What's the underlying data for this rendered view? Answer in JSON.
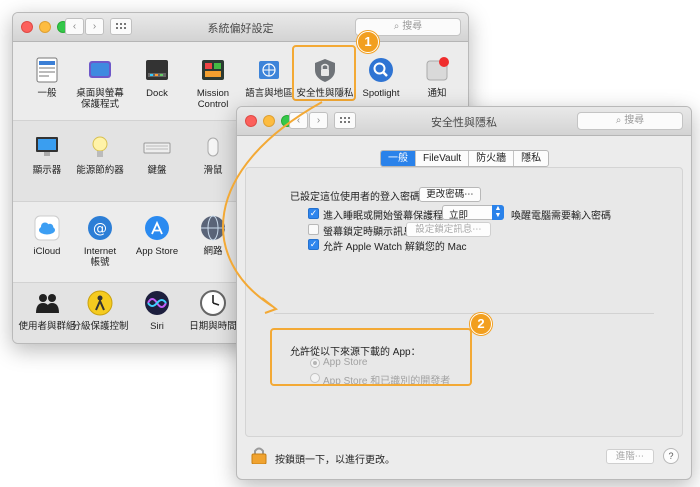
{
  "back_window": {
    "title": "系統偏好設定",
    "search_placeholder": "搜尋",
    "nav_back": "‹",
    "nav_forward": "›",
    "row1": [
      {
        "label": "一般",
        "icon": "general-icon"
      },
      {
        "label": "桌面與螢幕\n保護程式",
        "icon": "desktop-icon"
      },
      {
        "label": "Dock",
        "icon": "dock-icon"
      },
      {
        "label": "Mission\nControl",
        "icon": "mission-control-icon"
      },
      {
        "label": "語言與地區",
        "icon": "language-region-icon"
      },
      {
        "label": "安全性與隱私",
        "icon": "security-privacy-icon"
      },
      {
        "label": "Spotlight",
        "icon": "spotlight-icon"
      },
      {
        "label": "通知",
        "icon": "notifications-icon"
      }
    ],
    "row2": [
      {
        "label": "顯示器",
        "icon": "display-icon"
      },
      {
        "label": "能源節約器",
        "icon": "energy-saver-icon"
      },
      {
        "label": "鍵盤",
        "icon": "keyboard-icon"
      },
      {
        "label": "滑鼠",
        "icon": "mouse-icon"
      }
    ],
    "row3": [
      {
        "label": "iCloud",
        "icon": "icloud-icon"
      },
      {
        "label": "Internet\n帳號",
        "icon": "internet-accounts-icon"
      },
      {
        "label": "App Store",
        "icon": "app-store-icon"
      },
      {
        "label": "網路",
        "icon": "network-icon"
      }
    ],
    "row4": [
      {
        "label": "使用者與群組",
        "icon": "users-groups-icon"
      },
      {
        "label": "分級保護控制",
        "icon": "parental-controls-icon"
      },
      {
        "label": "Siri",
        "icon": "siri-icon"
      },
      {
        "label": "日期與時間",
        "icon": "date-time-icon"
      }
    ]
  },
  "front_window": {
    "title": "安全性與隱私",
    "search_placeholder": "搜尋",
    "tabs": [
      "一般",
      "FileVault",
      "防火牆",
      "隱私"
    ],
    "password_label": "已設定這位使用者的登入密碼",
    "change_password_button": "更改密碼⋯",
    "require_password_label": "進入睡眠或開始螢幕保護程式",
    "require_password_value": "立即",
    "require_password_suffix": "喚醒電腦需要輸入密碼",
    "show_message_label": "螢幕鎖定時顯示訊息",
    "set_lock_message_button": "設定鎖定訊息⋯",
    "apple_watch_label": "允許 Apple Watch 解鎖您的 Mac",
    "allow_apps_heading": "允許從以下來源下載的 App：",
    "radio_options": [
      "App Store",
      "App Store 和已識別的開發者"
    ],
    "lock_hint": "按鎖頭一下，以進行更改。",
    "advanced_button": "進階⋯",
    "help_button": "?"
  },
  "callouts": [
    "1",
    "2"
  ],
  "colors": {
    "accent": "#2a82ea",
    "callout": "#f29f1f"
  }
}
